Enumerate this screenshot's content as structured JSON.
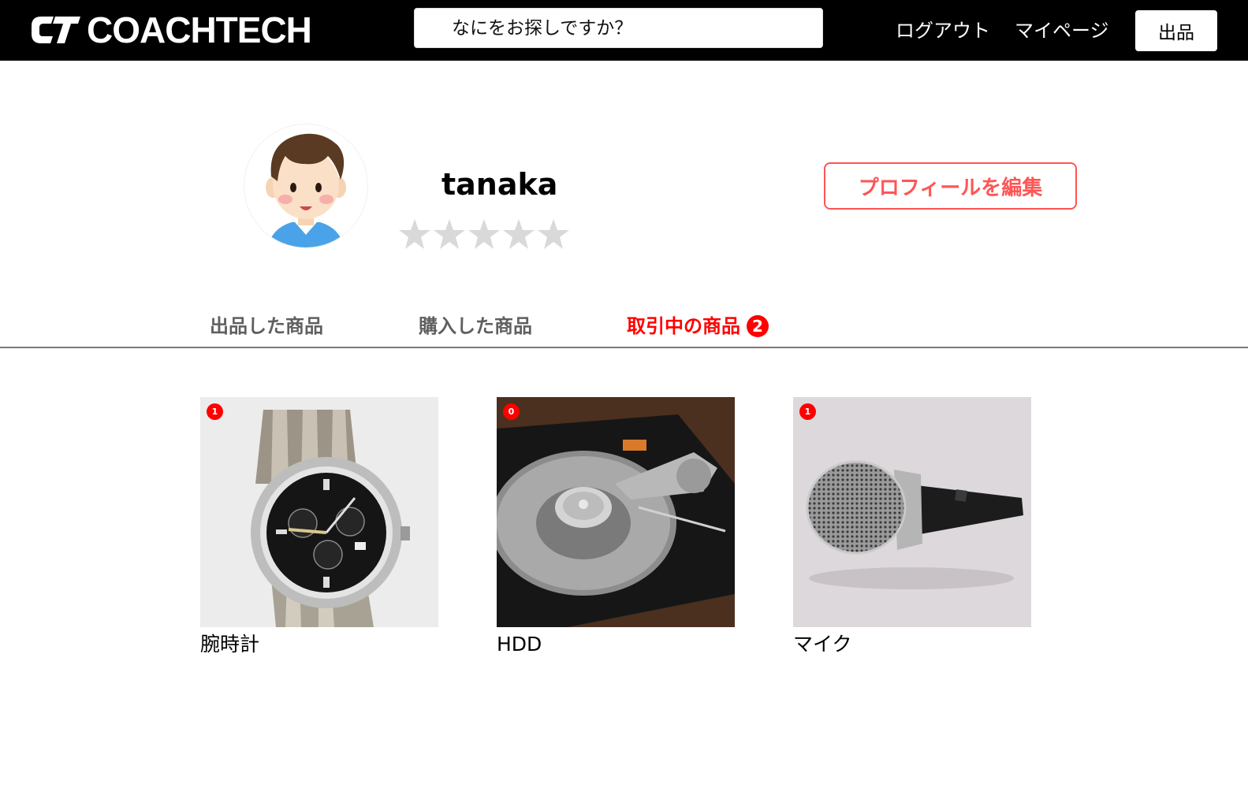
{
  "header": {
    "logo_text": "COACHTECH",
    "search_placeholder": "なにをお探しですか？",
    "logout_label": "ログアウト",
    "mypage_label": "マイページ",
    "sell_label": "出品"
  },
  "profile": {
    "username": "tanaka",
    "rating": 0,
    "rating_max": 5,
    "edit_label": "プロフィールを編集"
  },
  "tabs": [
    {
      "label": "出品した商品",
      "active": false
    },
    {
      "label": "購入した商品",
      "active": false
    },
    {
      "label": "取引中の商品",
      "active": true,
      "badge": "2"
    }
  ],
  "items": [
    {
      "name": "腕時計",
      "badge": "1",
      "icon": "watch-image"
    },
    {
      "name": "HDD",
      "badge": "0",
      "icon": "hdd-image"
    },
    {
      "name": "マイク",
      "badge": "1",
      "icon": "microphone-image"
    }
  ],
  "colors": {
    "accent": "#ff0000",
    "edit_border": "#ff5555",
    "header_bg": "#000000",
    "star_empty": "#d9d9d9"
  }
}
